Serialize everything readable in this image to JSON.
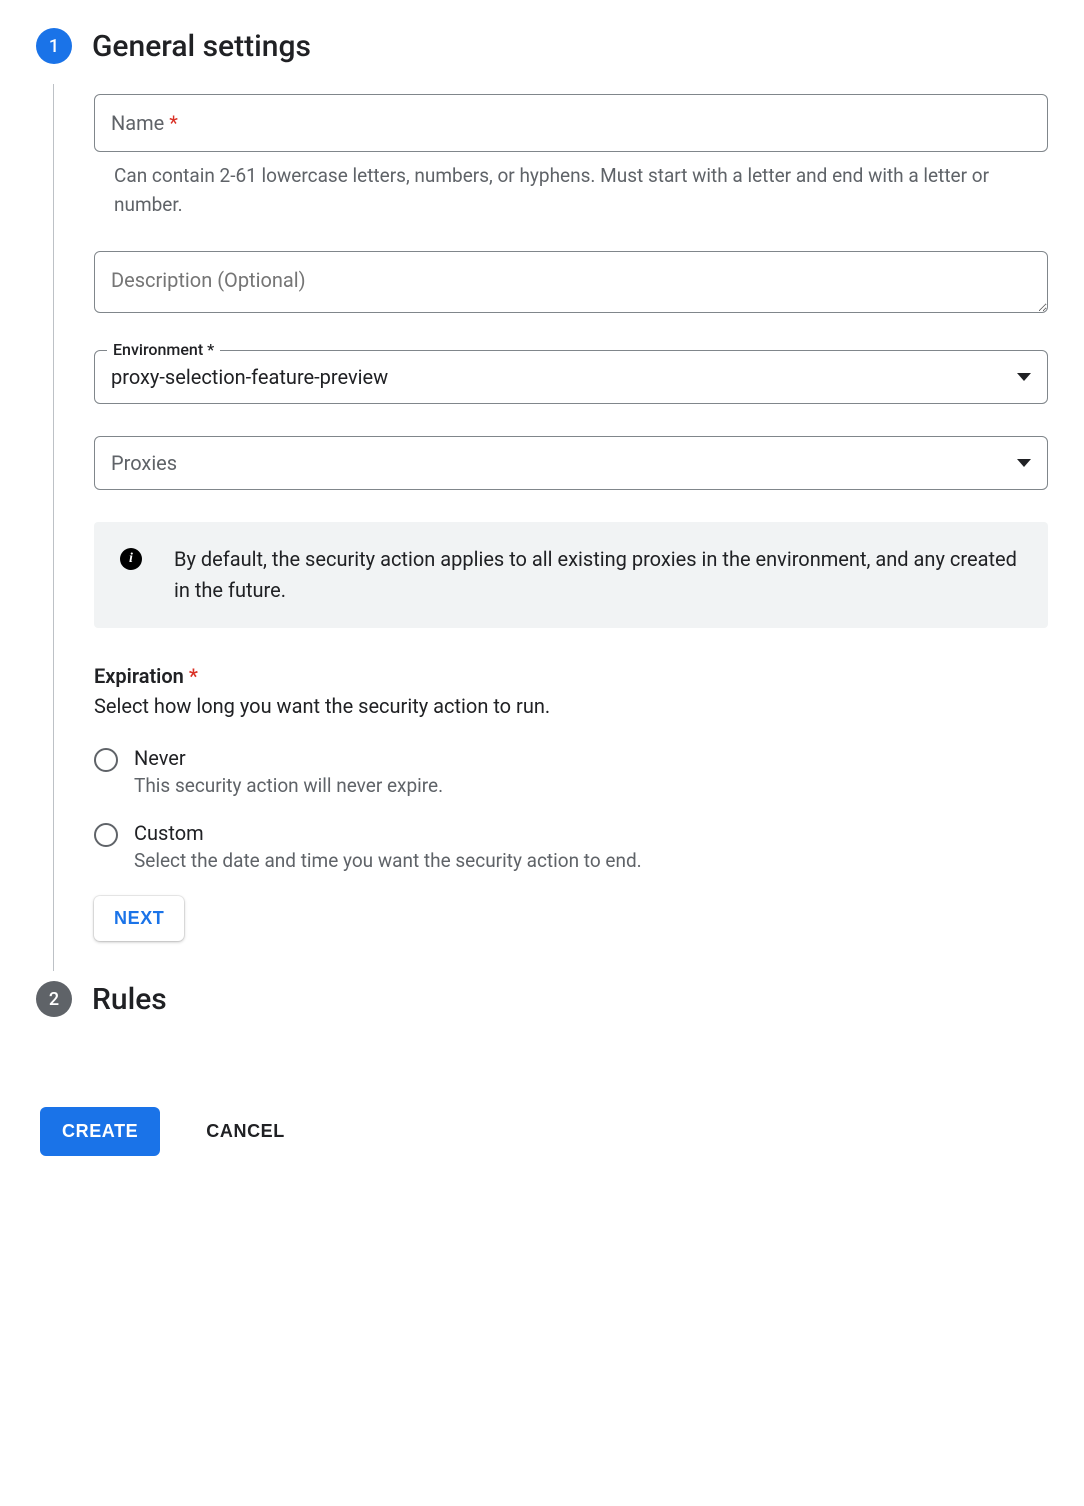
{
  "steps": {
    "general": {
      "number": "1",
      "title": "General settings"
    },
    "rules": {
      "number": "2",
      "title": "Rules"
    }
  },
  "fields": {
    "name": {
      "label": "Name",
      "required_marker": "*",
      "value": "",
      "helper": "Can contain 2-61 lowercase letters, numbers, or hyphens. Must start with a letter and end with a letter or number."
    },
    "description": {
      "label": "Description (Optional)",
      "value": ""
    },
    "environment": {
      "label": "Environment",
      "required_marker": "*",
      "value": "proxy-selection-feature-preview"
    },
    "proxies": {
      "label": "Proxies"
    }
  },
  "info_banner": {
    "text": "By default, the security action applies to all existing proxies in the environment, and any created in the future."
  },
  "expiration": {
    "label": "Expiration",
    "required_marker": "*",
    "description": "Select how long you want the security action to run.",
    "options": {
      "never": {
        "title": "Never",
        "desc": "This security action will never expire."
      },
      "custom": {
        "title": "Custom",
        "desc": "Select the date and time you want the security action to end."
      }
    }
  },
  "buttons": {
    "next": "NEXT",
    "create": "CREATE",
    "cancel": "CANCEL"
  }
}
